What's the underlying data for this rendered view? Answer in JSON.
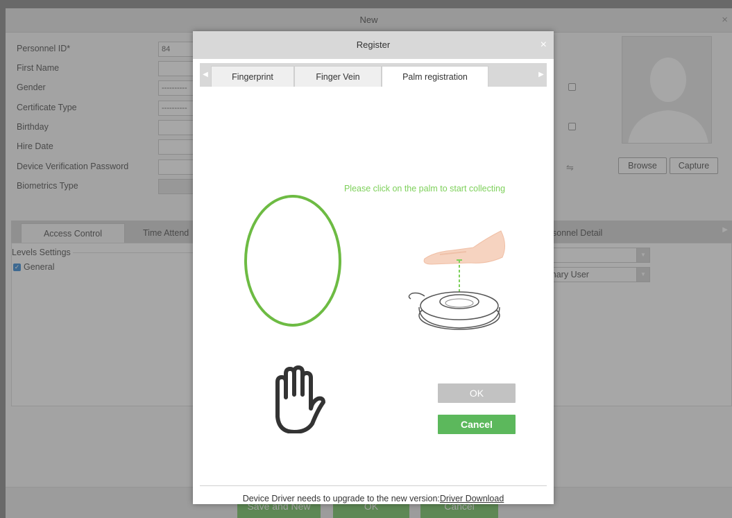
{
  "background_window": {
    "title": "New",
    "close_glyph": "×",
    "fields": [
      {
        "label": "Personnel ID*",
        "value": "84"
      },
      {
        "label": "First Name",
        "value": ""
      },
      {
        "label": "Gender",
        "value": "----------"
      },
      {
        "label": "Certificate Type",
        "value": "----------"
      },
      {
        "label": "Birthday",
        "value": ""
      },
      {
        "label": "Hire Date",
        "value": ""
      },
      {
        "label": "Device Verification Password",
        "value": ""
      },
      {
        "label": "Biometrics Type",
        "value": ""
      }
    ],
    "browse_label": "Browse",
    "capture_label": "Capture",
    "tabs": {
      "access_control": "Access Control",
      "time_attendance": "Time Attend",
      "personnel_detail": "sonnel Detail"
    },
    "levels_settings_label": "Levels Settings",
    "general_label": "General",
    "user_select_value": "inary User",
    "footer_buttons": {
      "save_and_new": "Save and New",
      "ok": "OK",
      "cancel": "Cancel"
    }
  },
  "dialog": {
    "title": "Register",
    "close_glyph": "×",
    "tabs": [
      {
        "label": "Fingerprint"
      },
      {
        "label": "Finger Vein"
      },
      {
        "label": "Palm registration"
      }
    ],
    "instruction": "Please click on the palm to start collecting",
    "ok_label": "OK",
    "cancel_label": "Cancel",
    "driver_note": "Device Driver needs to upgrade to the new version:",
    "driver_link": "Driver Download"
  },
  "colors": {
    "accent_green": "#5cb85c",
    "instruction_green": "#7dd05a",
    "palm_oval_green": "#6dbb43",
    "disabled_gray": "#c2c2c2"
  }
}
